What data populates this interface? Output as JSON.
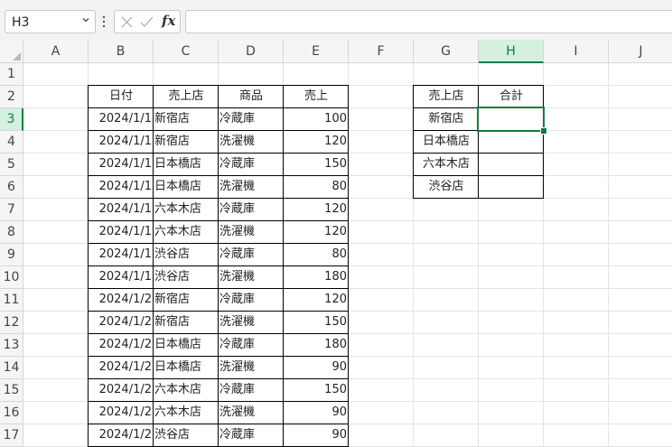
{
  "formula_bar": {
    "name_box": "H3",
    "cancel_icon": "close-icon",
    "enter_icon": "check-icon",
    "fx_label": "fx",
    "formula": ""
  },
  "columns": [
    "A",
    "B",
    "C",
    "D",
    "E",
    "F",
    "G",
    "H",
    "I",
    "J"
  ],
  "rows": [
    "1",
    "2",
    "3",
    "4",
    "5",
    "6",
    "7",
    "8",
    "9",
    "10",
    "11",
    "12",
    "13",
    "14",
    "15",
    "16",
    "17"
  ],
  "selected_cell": {
    "column": "H",
    "row": "3"
  },
  "sales_table": {
    "headers": [
      "日付",
      "売上店",
      "商品",
      "売上"
    ],
    "rows": [
      [
        "2024/1/1",
        "新宿店",
        "冷蔵庫",
        "100"
      ],
      [
        "2024/1/1",
        "新宿店",
        "洗濯機",
        "120"
      ],
      [
        "2024/1/1",
        "日本橋店",
        "冷蔵庫",
        "150"
      ],
      [
        "2024/1/1",
        "日本橋店",
        "洗濯機",
        "80"
      ],
      [
        "2024/1/1",
        "六本木店",
        "冷蔵庫",
        "120"
      ],
      [
        "2024/1/1",
        "六本木店",
        "洗濯機",
        "120"
      ],
      [
        "2024/1/1",
        "渋谷店",
        "冷蔵庫",
        "80"
      ],
      [
        "2024/1/1",
        "渋谷店",
        "洗濯機",
        "180"
      ],
      [
        "2024/1/2",
        "新宿店",
        "冷蔵庫",
        "120"
      ],
      [
        "2024/1/2",
        "新宿店",
        "洗濯機",
        "150"
      ],
      [
        "2024/1/2",
        "日本橋店",
        "冷蔵庫",
        "180"
      ],
      [
        "2024/1/2",
        "日本橋店",
        "洗濯機",
        "90"
      ],
      [
        "2024/1/2",
        "六本木店",
        "冷蔵庫",
        "150"
      ],
      [
        "2024/1/2",
        "六本木店",
        "洗濯機",
        "90"
      ],
      [
        "2024/1/2",
        "渋谷店",
        "冷蔵庫",
        "90"
      ]
    ]
  },
  "summary_table": {
    "headers": [
      "売上店",
      "合計"
    ],
    "rows": [
      [
        "新宿店",
        ""
      ],
      [
        "日本橋店",
        ""
      ],
      [
        "六本木店",
        ""
      ],
      [
        "渋谷店",
        ""
      ]
    ]
  },
  "colors": {
    "selection": "#107c41",
    "header_bg": "#f5f5f5"
  }
}
